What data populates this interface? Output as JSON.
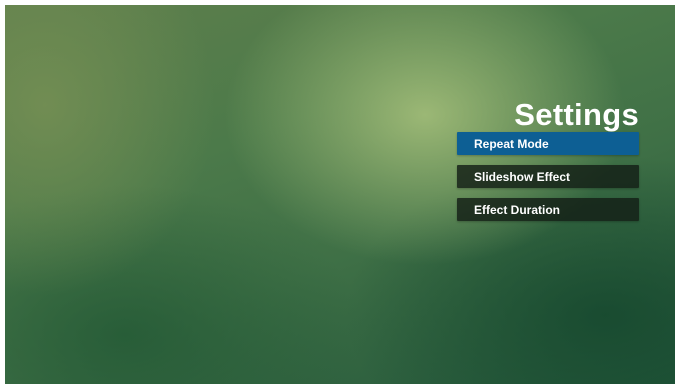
{
  "screen": {
    "title": "Settings"
  },
  "menu": {
    "items": [
      {
        "label": "Repeat Mode",
        "selected": true
      },
      {
        "label": "Slideshow Effect",
        "selected": false
      },
      {
        "label": "Effect Duration",
        "selected": false
      }
    ]
  },
  "colors": {
    "selected_item": "#0d5f94",
    "item_background": "#1a231c",
    "text": "#ffffff"
  }
}
